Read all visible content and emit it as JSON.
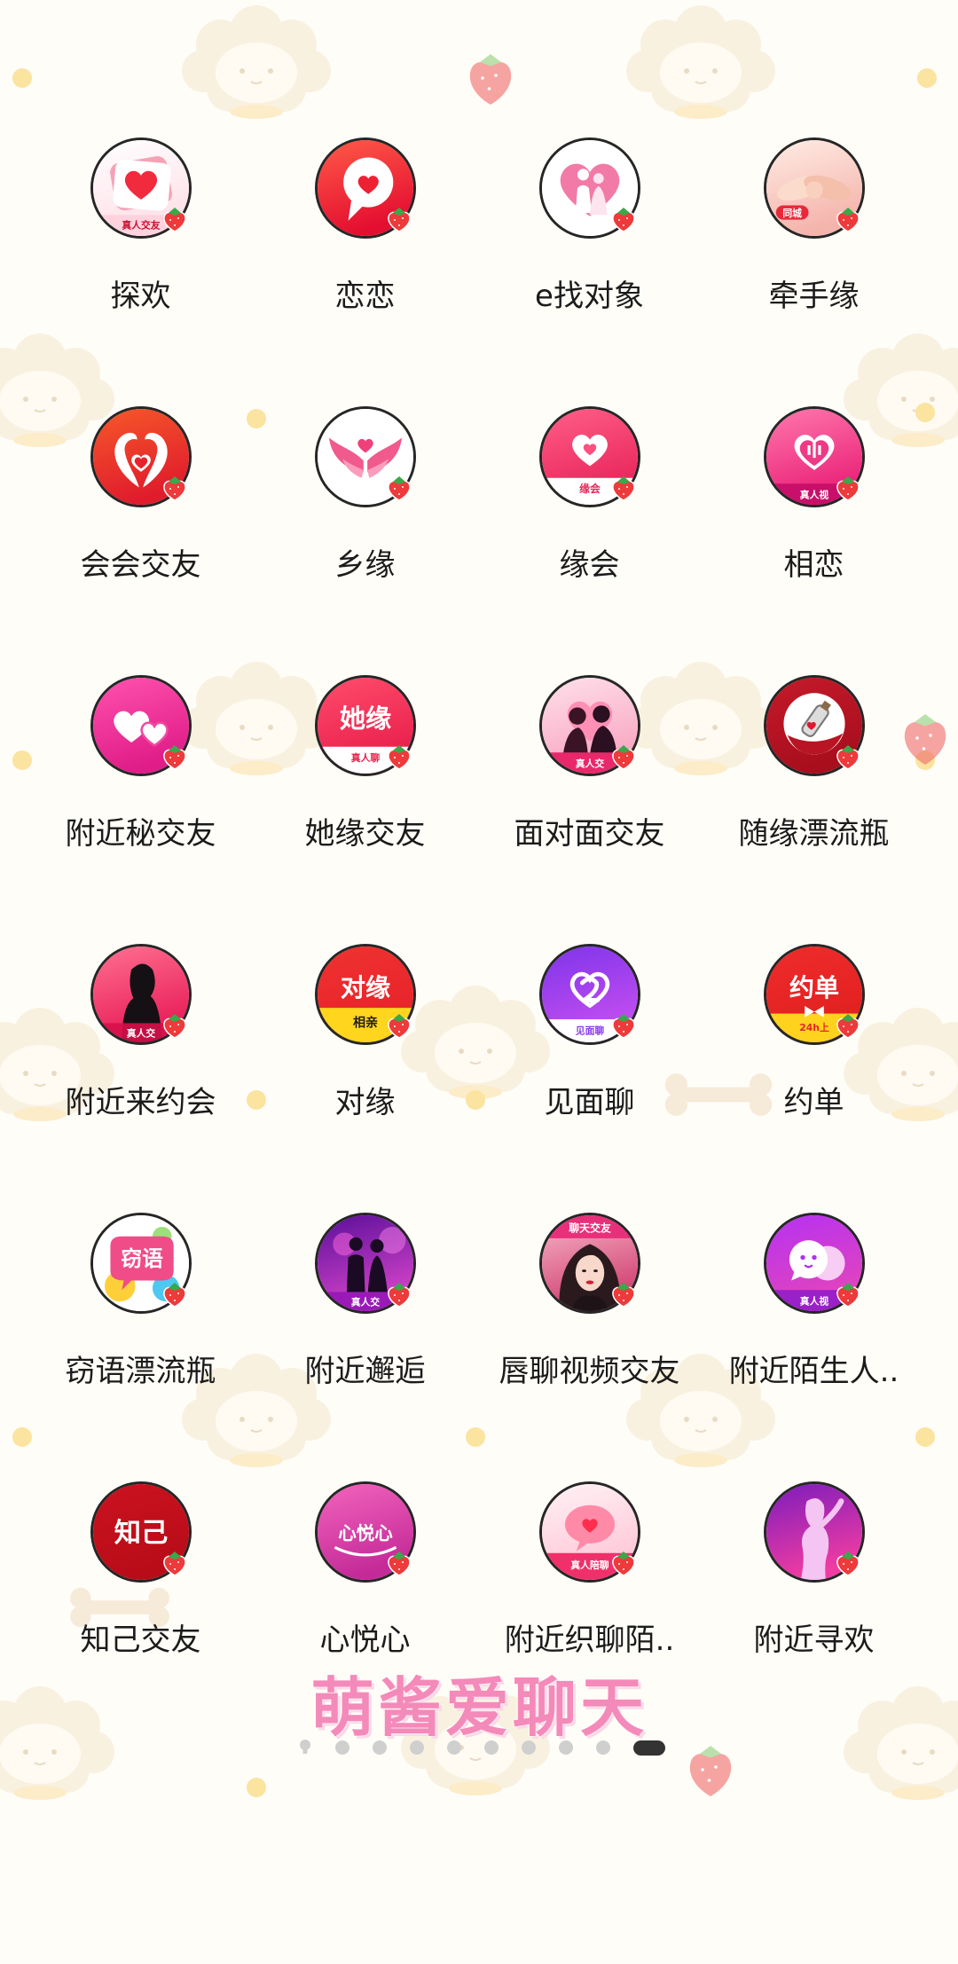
{
  "apps": [
    {
      "label": "探欢",
      "icon": "heart-card",
      "sub": "真人交友",
      "colors": [
        "#ffffff",
        "#fde0e8"
      ]
    },
    {
      "label": "恋恋",
      "icon": "pin-heart",
      "colors": [
        "#ff5a48",
        "#e40e30"
      ]
    },
    {
      "label": "e找对象",
      "icon": "heart-couple",
      "colors": [
        "#ffffff",
        "#ffffff"
      ]
    },
    {
      "label": "牵手缘",
      "icon": "hands",
      "sub": "同城",
      "colors": [
        "#ffece4",
        "#f4b4ac"
      ]
    },
    {
      "label": "会会交友",
      "icon": "dolphins",
      "colors": [
        "#f6582a",
        "#e01c2c"
      ]
    },
    {
      "label": "乡缘",
      "icon": "wings",
      "colors": [
        "#ffffff",
        "#ffffff"
      ]
    },
    {
      "label": "缘会",
      "icon": "heart-white",
      "sub": "缘会",
      "colors": [
        "#ff5e88",
        "#e8245a"
      ]
    },
    {
      "label": "相恋",
      "icon": "heart-frame",
      "sub": "真人视",
      "colors": [
        "#ff78ac",
        "#ea2078"
      ]
    },
    {
      "label": "附近秘交友",
      "icon": "double-hearts",
      "colors": [
        "#ff52ae",
        "#e01c88"
      ]
    },
    {
      "label": "她缘交友",
      "icon": "text-big",
      "inner": "她缘",
      "sub": "真人聊",
      "colors": [
        "#ff4c6c",
        "#e81e4a"
      ]
    },
    {
      "label": "面对面交友",
      "icon": "couple-face",
      "sub": "真人交",
      "colors": [
        "#ffe0ea",
        "#f8a6c2"
      ]
    },
    {
      "label": "随缘漂流瓶",
      "icon": "bottle",
      "colors": [
        "#c41a2a",
        "#a80e1c"
      ]
    },
    {
      "label": "附近来约会",
      "icon": "woman-silhouette",
      "sub": "真人交",
      "colors": [
        "#ff7090",
        "#e81c58"
      ]
    },
    {
      "label": "对缘",
      "icon": "duiyuan",
      "inner": "对缘",
      "sub": "相亲",
      "colors": [
        "#f03230",
        "#e6222a"
      ]
    },
    {
      "label": "见面聊",
      "icon": "heart-two",
      "sub": "见面聊",
      "colors": [
        "#7e34ea",
        "#c44ef0"
      ]
    },
    {
      "label": "约单",
      "icon": "yuedan",
      "inner": "约单",
      "sub": "24h上",
      "colors": [
        "#ee2c2c",
        "#e0201e"
      ]
    },
    {
      "label": "窃语漂流瓶",
      "icon": "speech-bubble",
      "inner": "窃语",
      "colors": [
        "#ffffff",
        "#ffffff"
      ]
    },
    {
      "label": "附近邂逅",
      "icon": "couple-dark",
      "sub": "真人交",
      "colors": [
        "#5a0f9a",
        "#d242c8"
      ]
    },
    {
      "label": "唇聊视频交友",
      "icon": "photo-woman",
      "sub": "聊天交友",
      "colors": [
        "#f8b8cc",
        "#d04070"
      ]
    },
    {
      "label": "附近陌生人..",
      "icon": "bubble-face",
      "sub": "真人视",
      "colors": [
        "#b632f2",
        "#e244bc"
      ]
    },
    {
      "label": "知己交友",
      "icon": "text-zhiji",
      "inner": "知己",
      "colors": [
        "#cc1220",
        "#b80c18"
      ]
    },
    {
      "label": "心悦心",
      "icon": "text-xinyuexin",
      "inner": "心悦心",
      "colors": [
        "#f264bc",
        "#c42a98"
      ]
    },
    {
      "label": "附近织聊陌..",
      "icon": "bubble-heart",
      "sub": "真人陪聊",
      "colors": [
        "#fff2f6",
        "#ffc6d6"
      ]
    },
    {
      "label": "附近寻欢",
      "icon": "silhouette-light",
      "colors": [
        "#7c1cbc",
        "#f03ca2"
      ]
    }
  ],
  "watermark": "萌酱爱聊天",
  "page_indicator": {
    "total": 10,
    "current": 10,
    "first_icon": "lightbulb-icon"
  },
  "colors": {
    "label": "#1b1b1b",
    "watermark": "#f48ab9",
    "dot": "#cfcfcf",
    "dot_active": "#333333",
    "badge": "#ee3a3a"
  }
}
